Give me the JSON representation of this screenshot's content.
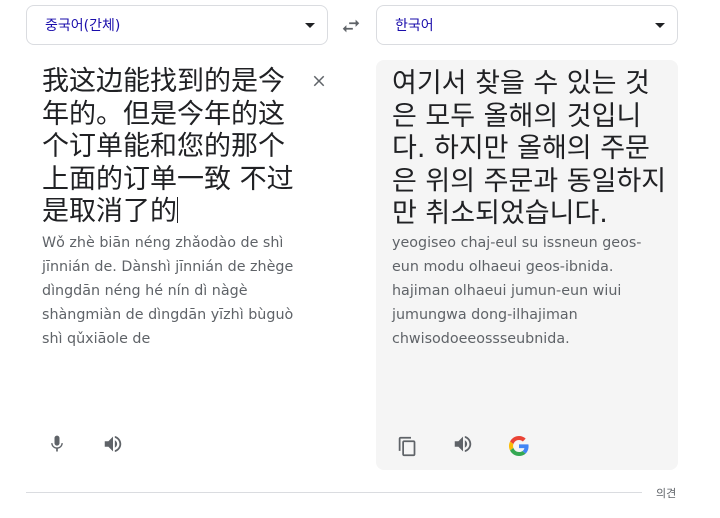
{
  "source": {
    "language": "중국어(간체)",
    "text": "我这边能找到的是今年的。但是今年的这个订单能和您的那个上面的订单一致 不过是取消了的",
    "romanization": "Wǒ zhè biān néng zhǎodào de shì jīnnián de. Dànshì jīnnián de zhège dìngdān néng hé nín dì nàgè shàngmiàn de dìngdān yīzhì bùguò shì qǔxiāole de"
  },
  "target": {
    "language": "한국어",
    "text": "여기서 찾을 수 있는 것은 모두 올해의 것입니다. 하지만 올해의 주문은 위의 주문과 동일하지만 취소되었습니다.",
    "romanization": "yeogiseo chaj-eul su issneun geos-eun modu olhaeui geos-ibnida. hajiman olhaeui jumun-eun wiui jumungwa dong-ilhajiman chwisodoeeossseubnida."
  },
  "footer": {
    "feedback_label": "의견"
  },
  "icons": {
    "swap": "swap-arrows-icon",
    "clear": "close-icon",
    "mic": "microphone-icon",
    "listen": "speaker-icon",
    "copy": "copy-icon",
    "google": "google-logo-icon"
  },
  "colors": {
    "accent": "#1a0dab",
    "icon": "#5f6368",
    "panel_bg": "#f5f5f5"
  }
}
